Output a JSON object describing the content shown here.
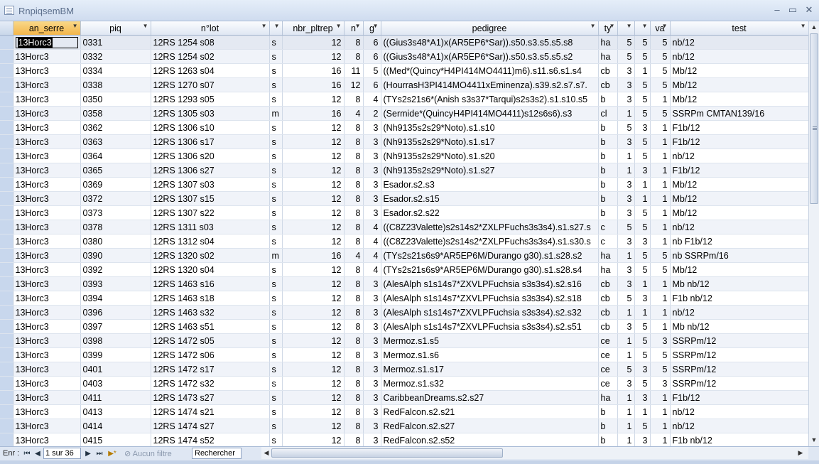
{
  "window": {
    "title": "RnpiqsemBM",
    "minimize": "‒",
    "restore": "▭",
    "close": "✕"
  },
  "grid": {
    "headers": [
      "",
      "an_serre",
      "piq",
      "n°lot",
      "",
      "nbr_pltrep",
      "n",
      "g",
      "pedigree",
      "ty",
      "",
      "",
      "va",
      "test"
    ],
    "rows": [
      [
        "13Horc3",
        "0331",
        "12RS 1254 s08",
        "s",
        "12",
        "8",
        "6",
        "((Gius3s48*A1)x(AR5EP6*Sar)).s50.s3.s5.s5.s8",
        "ha",
        "5",
        "5",
        "5",
        "nb/12"
      ],
      [
        "13Horc3",
        "0332",
        "12RS 1254 s02",
        "s",
        "12",
        "8",
        "6",
        "((Gius3s48*A1)x(AR5EP6*Sar)).s50.s3.s5.s5.s2",
        "ha",
        "5",
        "5",
        "5",
        "nb/12"
      ],
      [
        "13Horc3",
        "0334",
        "12RS 1263 s04",
        "s",
        "16",
        "11",
        "5",
        "((Med*(Quincy*H4PI414MO4411)m6).s11.s6.s1.s4",
        "cb",
        "3",
        "1",
        "5",
        "Mb/12"
      ],
      [
        "13Horc3",
        "0338",
        "12RS 1270 s07",
        "s",
        "16",
        "12",
        "6",
        "(HourrasH3PI414MO4411xEminenza).s39.s2.s7.s7.",
        "cb",
        "3",
        "5",
        "5",
        "Mb/12"
      ],
      [
        "13Horc3",
        "0350",
        "12RS 1293 s05",
        "s",
        "12",
        "8",
        "4",
        "(TYs2s21s6*(Anish s3s37*Tarqui)s2s3s2).s1.s10.s5",
        "b",
        "3",
        "5",
        "1",
        "Mb/12"
      ],
      [
        "13Horc3",
        "0358",
        "12RS 1305 s03",
        "m",
        "16",
        "4",
        "2",
        "(Sermide*(QuincyH4PI414MO4411)s12s6s6).s3",
        "cl",
        "1",
        "5",
        "5",
        "SSRPm CMTAN139/16"
      ],
      [
        "13Horc3",
        "0362",
        "12RS 1306 s10",
        "s",
        "12",
        "8",
        "3",
        "(Nh9135s2s29*Noto).s1.s10",
        "b",
        "5",
        "3",
        "1",
        "F1b/12"
      ],
      [
        "13Horc3",
        "0363",
        "12RS 1306 s17",
        "s",
        "12",
        "8",
        "3",
        "(Nh9135s2s29*Noto).s1.s17",
        "b",
        "3",
        "5",
        "1",
        "F1b/12"
      ],
      [
        "13Horc3",
        "0364",
        "12RS 1306 s20",
        "s",
        "12",
        "8",
        "3",
        "(Nh9135s2s29*Noto).s1.s20",
        "b",
        "1",
        "5",
        "1",
        "nb/12"
      ],
      [
        "13Horc3",
        "0365",
        "12RS 1306 s27",
        "s",
        "12",
        "8",
        "3",
        "(Nh9135s2s29*Noto).s1.s27",
        "b",
        "1",
        "3",
        "1",
        "F1b/12"
      ],
      [
        "13Horc3",
        "0369",
        "12RS 1307 s03",
        "s",
        "12",
        "8",
        "3",
        "Esador.s2.s3",
        "b",
        "3",
        "1",
        "1",
        "Mb/12"
      ],
      [
        "13Horc3",
        "0372",
        "12RS 1307 s15",
        "s",
        "12",
        "8",
        "3",
        "Esador.s2.s15",
        "b",
        "3",
        "1",
        "1",
        "Mb/12"
      ],
      [
        "13Horc3",
        "0373",
        "12RS 1307 s22",
        "s",
        "12",
        "8",
        "3",
        "Esador.s2.s22",
        "b",
        "3",
        "5",
        "1",
        "Mb/12"
      ],
      [
        "13Horc3",
        "0378",
        "12RS 1311 s03",
        "s",
        "12",
        "8",
        "4",
        "((C8Z23Valette)s2s14s2*ZXLPFuchs3s3s4).s1.s27.s",
        "c",
        "5",
        "5",
        "1",
        "nb/12"
      ],
      [
        "13Horc3",
        "0380",
        "12RS 1312 s04",
        "s",
        "12",
        "8",
        "4",
        "((C8Z23Valette)s2s14s2*ZXLPFuchs3s3s4).s1.s30.s",
        "c",
        "3",
        "3",
        "1",
        "nb F1b/12"
      ],
      [
        "13Horc3",
        "0390",
        "12RS 1320 s02",
        "m",
        "16",
        "4",
        "4",
        "(TYs2s21s6s9*AR5EP6M/Durango g30).s1.s28.s2",
        "ha",
        "1",
        "5",
        "5",
        "nb SSRPm/16"
      ],
      [
        "13Horc3",
        "0392",
        "12RS 1320 s04",
        "s",
        "12",
        "8",
        "4",
        "(TYs2s21s6s9*AR5EP6M/Durango g30).s1.s28.s4",
        "ha",
        "3",
        "5",
        "5",
        "Mb/12"
      ],
      [
        "13Horc3",
        "0393",
        "12RS 1463 s16",
        "s",
        "12",
        "8",
        "3",
        "(AlesAlph s1s14s7*ZXVLPFuchsia s3s3s4).s2.s16",
        "cb",
        "3",
        "1",
        "1",
        "Mb nb/12"
      ],
      [
        "13Horc3",
        "0394",
        "12RS 1463 s18",
        "s",
        "12",
        "8",
        "3",
        "(AlesAlph s1s14s7*ZXVLPFuchsia s3s3s4).s2.s18",
        "cb",
        "5",
        "3",
        "1",
        "F1b nb/12"
      ],
      [
        "13Horc3",
        "0396",
        "12RS 1463 s32",
        "s",
        "12",
        "8",
        "3",
        "(AlesAlph s1s14s7*ZXVLPFuchsia s3s3s4).s2.s32",
        "cb",
        "1",
        "1",
        "1",
        "nb/12"
      ],
      [
        "13Horc3",
        "0397",
        "12RS 1463 s51",
        "s",
        "12",
        "8",
        "3",
        "(AlesAlph s1s14s7*ZXVLPFuchsia s3s3s4).s2.s51",
        "cb",
        "3",
        "5",
        "1",
        "Mb nb/12"
      ],
      [
        "13Horc3",
        "0398",
        "12RS 1472 s05",
        "s",
        "12",
        "8",
        "3",
        "Mermoz.s1.s5",
        "ce",
        "1",
        "5",
        "3",
        "SSRPm/12"
      ],
      [
        "13Horc3",
        "0399",
        "12RS 1472 s06",
        "s",
        "12",
        "8",
        "3",
        "Mermoz.s1.s6",
        "ce",
        "1",
        "5",
        "5",
        "SSRPm/12"
      ],
      [
        "13Horc3",
        "0401",
        "12RS 1472 s17",
        "s",
        "12",
        "8",
        "3",
        "Mermoz.s1.s17",
        "ce",
        "5",
        "3",
        "5",
        "SSRPm/12"
      ],
      [
        "13Horc3",
        "0403",
        "12RS 1472 s32",
        "s",
        "12",
        "8",
        "3",
        "Mermoz.s1.s32",
        "ce",
        "3",
        "5",
        "3",
        "SSRPm/12"
      ],
      [
        "13Horc3",
        "0411",
        "12RS 1473 s27",
        "s",
        "12",
        "8",
        "3",
        "CaribbeanDreams.s2.s27",
        "ha",
        "1",
        "3",
        "1",
        "F1b/12"
      ],
      [
        "13Horc3",
        "0413",
        "12RS 1474 s21",
        "s",
        "12",
        "8",
        "3",
        "RedFalcon.s2.s21",
        "b",
        "1",
        "1",
        "1",
        "nb/12"
      ],
      [
        "13Horc3",
        "0414",
        "12RS 1474 s27",
        "s",
        "12",
        "8",
        "3",
        "RedFalcon.s2.s27",
        "b",
        "1",
        "5",
        "1",
        "nb/12"
      ],
      [
        "13Horc3",
        "0415",
        "12RS 1474 s52",
        "s",
        "12",
        "8",
        "3",
        "RedFalcon.s2.s52",
        "b",
        "1",
        "3",
        "1",
        "F1b nb/12"
      ]
    ]
  },
  "navbar": {
    "record_label": "Enr :",
    "first": "⏮",
    "prev": "◀",
    "record_value": "1 sur 36",
    "next": "▶",
    "last": "⏭",
    "new": "▶*",
    "filter_label": "Aucun filtre",
    "search_label": "Rechercher"
  }
}
